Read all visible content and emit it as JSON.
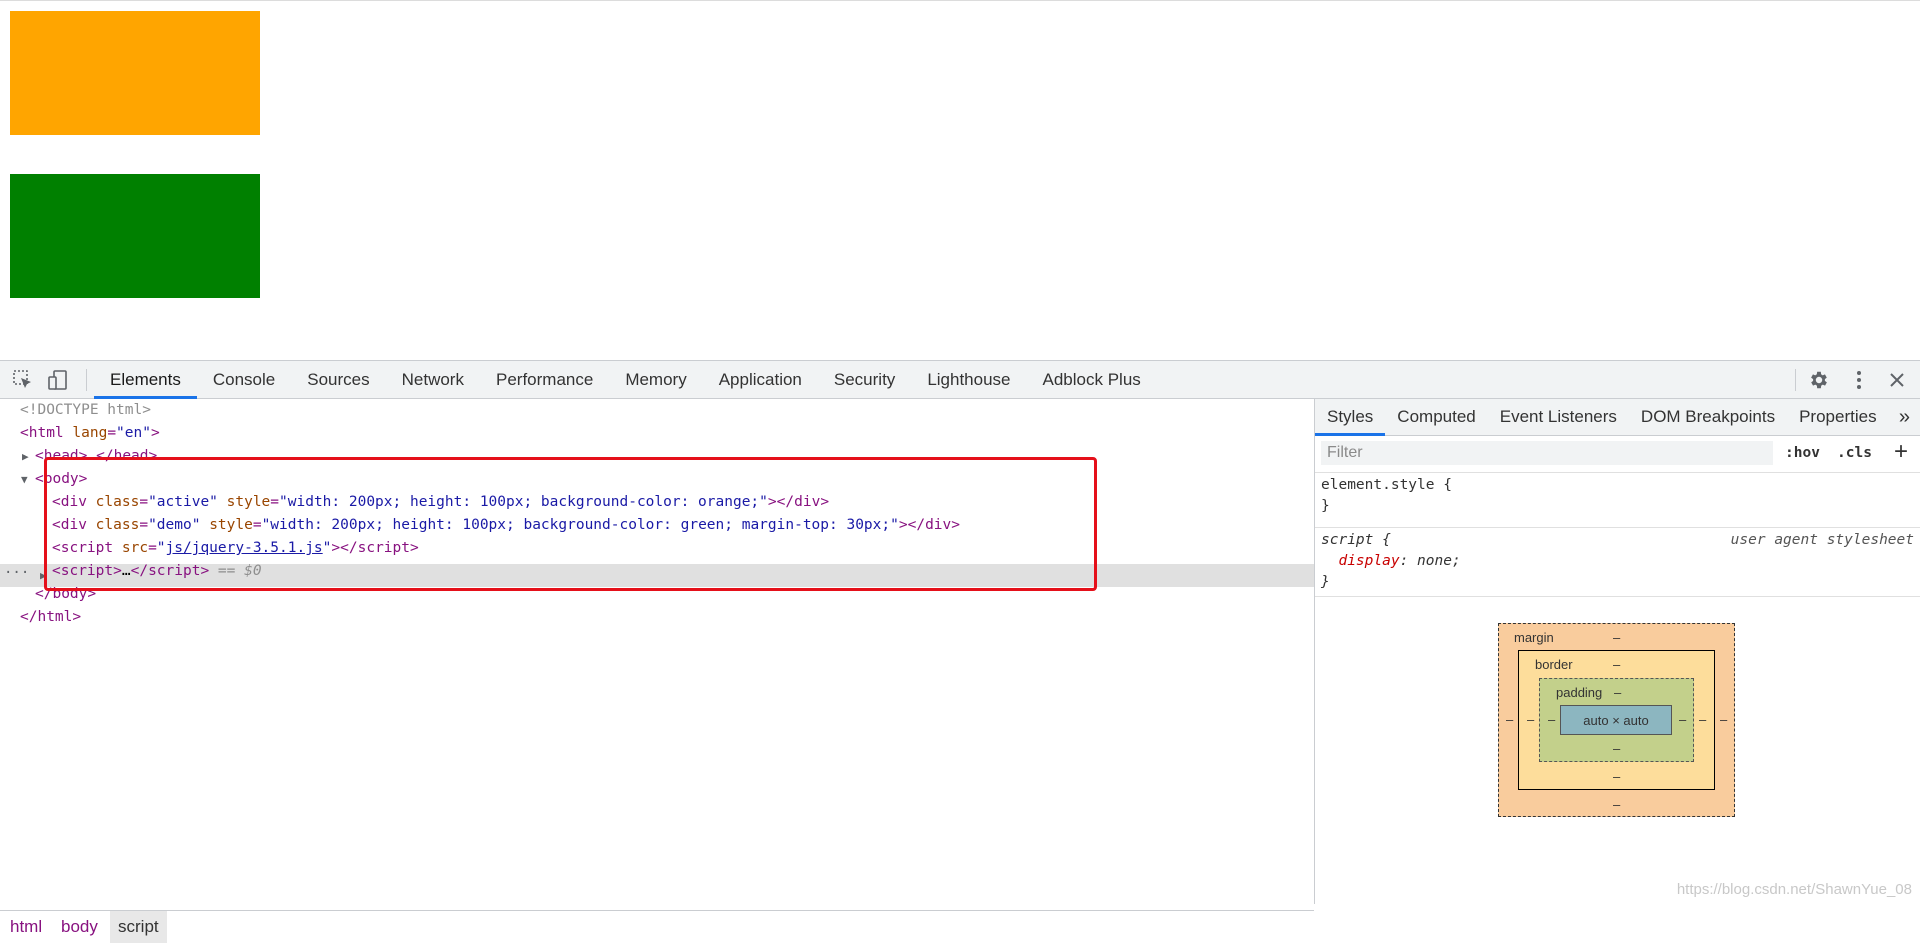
{
  "page": {
    "colors": {
      "orange_box": "#FFA500",
      "green_box": "#008000"
    }
  },
  "devtools": {
    "tabs": [
      "Elements",
      "Console",
      "Sources",
      "Network",
      "Performance",
      "Memory",
      "Application",
      "Security",
      "Lighthouse",
      "Adblock Plus"
    ],
    "active_tab": "Elements",
    "icons": [
      "inspect-element-icon",
      "device-toolbar-icon",
      "gear-icon",
      "more-vert-icon",
      "close-icon"
    ],
    "elements": {
      "doctype": "<!DOCTYPE html>",
      "html_tag": "html",
      "html_attr": "lang",
      "html_attr_value": "\"en\"",
      "head_collapsed": "head",
      "head_ellipsis": "…",
      "body_tag": "body",
      "div1": {
        "tag": "div",
        "class_value": "\"active\"",
        "style_value": "\"width: 200px; height: 100px; background-color: orange;\""
      },
      "div2": {
        "tag": "div",
        "class_value": "\"demo\"",
        "style_value": "\"width: 200px; height: 100px; background-color: green; margin-top: 30px;\""
      },
      "script1": {
        "tag": "script",
        "src_value": "js/jquery-3.5.1.js"
      },
      "script2": {
        "tag": "script",
        "ellipsis": "…",
        "selected_marker": "== $0"
      }
    },
    "breadcrumbs": [
      "html",
      "body",
      "script"
    ],
    "styles": {
      "tabs": [
        "Styles",
        "Computed",
        "Event Listeners",
        "DOM Breakpoints",
        "Properties"
      ],
      "active_tab": "Styles",
      "overflow": "»",
      "filter_placeholder": "Filter",
      "hov": ":hov",
      "cls": ".cls",
      "add": "+",
      "element_style": "element.style {",
      "close_brace": "}",
      "rule_selector": "script",
      "rule_source": "user agent stylesheet",
      "rule_property": "display",
      "rule_value": "none;",
      "box_model": {
        "margin_label": "margin",
        "border_label": "border",
        "padding_label": "padding",
        "content": "auto × auto",
        "dash": "–"
      }
    }
  },
  "watermark": "https://blog.csdn.net/ShawnYue_08"
}
